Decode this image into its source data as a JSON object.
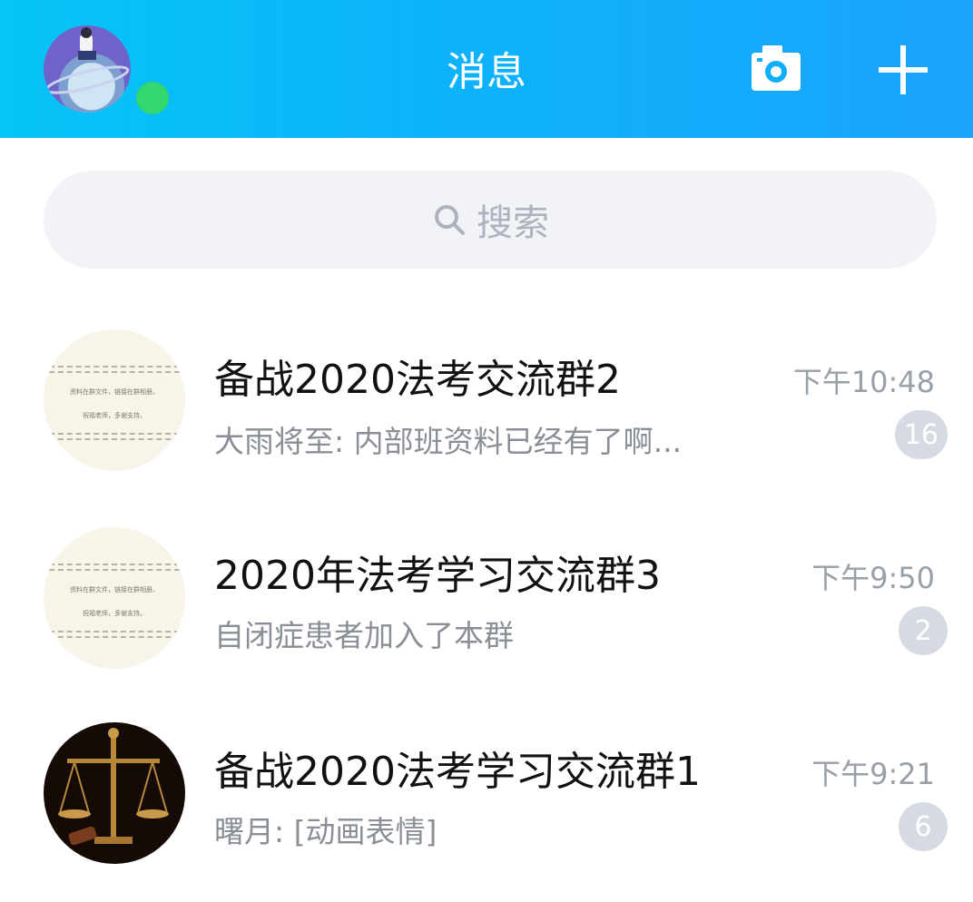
{
  "header": {
    "title": "消息",
    "camera_icon": "camera-icon",
    "add_icon": "plus-icon",
    "status_color": "#33d66f"
  },
  "search": {
    "placeholder": "搜索",
    "icon": "search-icon"
  },
  "conversations": [
    {
      "name": "备战2020法考交流群2",
      "last_message": "大雨将至: 内部班资料已经有了啊...",
      "time": "下午10:48",
      "unread": "16",
      "avatar_text": [
        "资料在群文件，链接在群相册。",
        "祝福老师，多谢支持。"
      ]
    },
    {
      "name": "2020年法考学习交流群3",
      "last_message": "自闭症患者加入了本群",
      "time": "下午9:50",
      "unread": "2",
      "avatar_text": [
        "资料在群文件，链接在群相册。",
        "祝福老师，多谢支持。"
      ]
    },
    {
      "name": "备战2020法考学习交流群1",
      "last_message": "曙月: [动画表情]",
      "time": "下午9:21",
      "unread": "6"
    }
  ]
}
